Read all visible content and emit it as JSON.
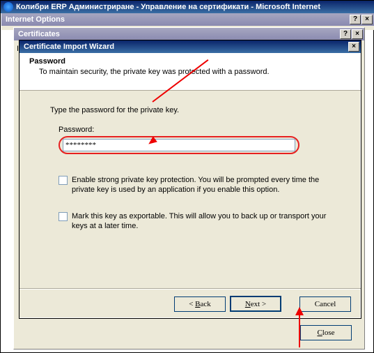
{
  "browser": {
    "title": "Колибри ERP Администриране - Управление на сертификати - Microsoft Internet"
  },
  "internet_options": {
    "title": "Internet Options"
  },
  "certificates": {
    "title": "Certificates",
    "personal_stub": "I",
    "close_label": "Close"
  },
  "wizard": {
    "title": "Certificate Import Wizard",
    "header": {
      "title": "Password",
      "subtitle": "To maintain security, the private key was protected with a password."
    },
    "body": {
      "prompt": "Type the password for the private key.",
      "password_label": "Password:",
      "password_value": "********",
      "check_strong": "Enable strong private key protection. You will be prompted every time the private key is used by an application if you enable this option.",
      "check_export": "Mark this key as exportable. This will allow you to back up or transport your keys at a later time."
    },
    "buttons": {
      "back": "Back",
      "back_prefix": "< ",
      "next": "Next >",
      "next_plain": "Next",
      "next_suffix": " >",
      "cancel": "Cancel"
    }
  }
}
